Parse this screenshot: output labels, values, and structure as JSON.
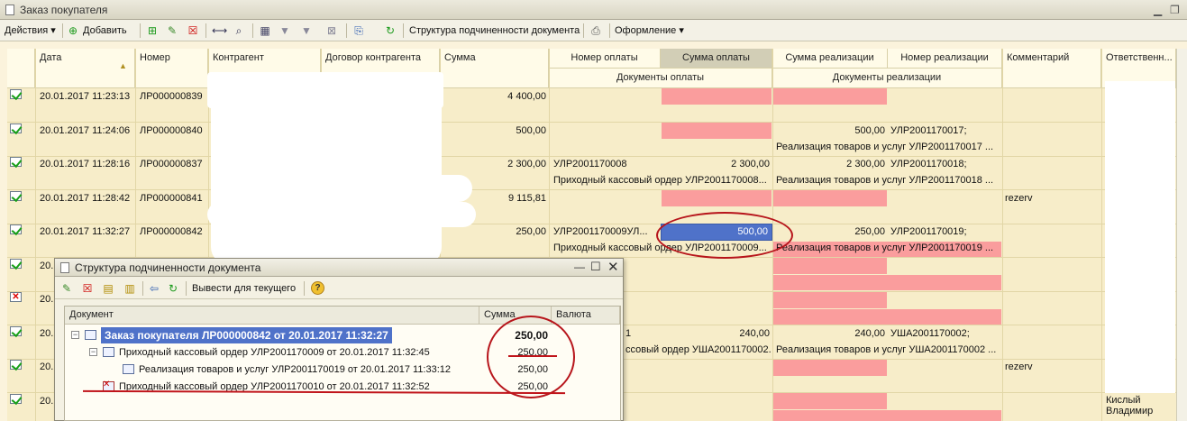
{
  "window": {
    "title": "Заказ  покупателя"
  },
  "toolbar": {
    "actions": "Действия",
    "add": "Добавить",
    "structure": "Структура подчиненности документа",
    "design": "Оформление"
  },
  "columns": {
    "date": "Дата",
    "number": "Номер",
    "counterparty": "Контрагент",
    "contract": "Договор контрагента",
    "amount": "Сумма",
    "payment_number": "Номер оплаты",
    "payment_amount": "Сумма оплаты",
    "sales_amount": "Сумма реализации",
    "sales_number": "Номер реализации",
    "comment": "Комментарий",
    "responsible": "Ответственн...",
    "payment_docs": "Документы оплаты",
    "sales_docs": "Документы реализации"
  },
  "rows": [
    {
      "date": "20.01.2017 11:23:13",
      "number": "ЛР000000839",
      "amount": "4 400,00"
    },
    {
      "date": "20.01.2017 11:24:06",
      "number": "ЛР000000840",
      "amount": "500,00",
      "sales_amount": "500,00",
      "sales_number": "УЛР2001170017;",
      "sales_doc": "Реализация товаров и услуг УЛР2001170017 ..."
    },
    {
      "date": "20.01.2017 11:28:16",
      "number": "ЛР000000837",
      "amount": "2 300,00",
      "pay_number": "УЛР2001170008",
      "pay_amount": "2 300,00",
      "pay_doc": "Приходный кассовый ордер УЛР2001170008...",
      "sales_amount": "2 300,00",
      "sales_number": "УЛР2001170018;",
      "sales_doc": "Реализация товаров и услуг УЛР2001170018 ..."
    },
    {
      "date": "20.01.2017 11:28:42",
      "number": "ЛР000000841",
      "amount": "9 115,81",
      "comment": "rezerv"
    },
    {
      "date": "20.01.2017 11:32:27",
      "number": "ЛР000000842",
      "amount": "250,00",
      "pay_number": "УЛР2001170009УЛ...",
      "pay_amount": "500,00",
      "pay_doc": "Приходный кассовый ордер УЛР2001170009...",
      "sales_amount": "250,00",
      "sales_number": "УЛР2001170019;",
      "sales_doc": "Реализация товаров и услуг УЛР2001170019 ..."
    },
    {
      "date": "20."
    },
    {
      "date": "20."
    },
    {
      "date": "20.",
      "pay_number": "1",
      "pay_amount": "240,00",
      "pay_doc": "ссовый ордер УША2001170002...",
      "sales_amount": "240,00",
      "sales_number": "УША2001170002;",
      "sales_doc": "Реализация товаров и услуг УША2001170002 ..."
    },
    {
      "date": "20.",
      "comment": "rezerv"
    },
    {
      "date": "20.",
      "responsible": "Кислый Владимир"
    }
  ],
  "dialog": {
    "title": "Структура подчиненности документа",
    "output_button": "Вывести для текущего",
    "help": "?",
    "col_document": "Документ",
    "col_amount": "Сумма",
    "col_currency": "Валюта",
    "tree": [
      {
        "label": "Заказ покупателя ЛР000000842 от 20.01.2017 11:32:27",
        "amount": "250,00"
      },
      {
        "label": "Приходный кассовый ордер УЛР2001170009 от 20.01.2017 11:32:45",
        "amount": "250,00"
      },
      {
        "label": "Реализация товаров и услуг УЛР2001170019 от 20.01.2017 11:33:12",
        "amount": "250,00"
      },
      {
        "label": "Приходный кассовый ордер УЛР2001170010 от 20.01.2017 11:32:52",
        "amount": "250,00"
      }
    ]
  }
}
